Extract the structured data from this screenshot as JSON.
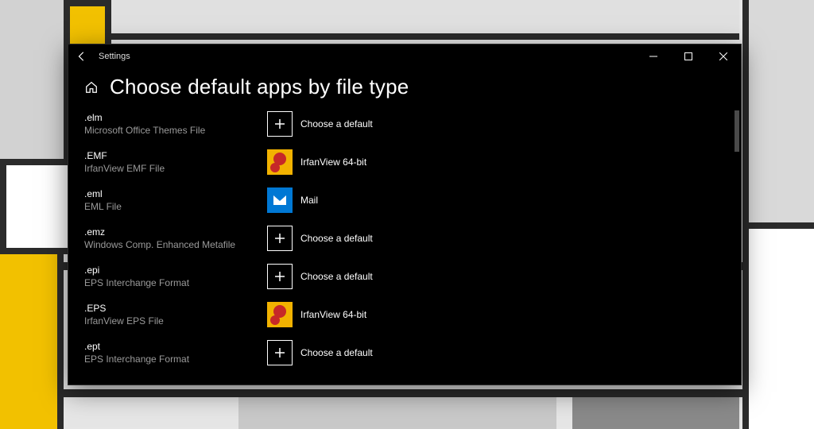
{
  "window": {
    "app_name": "Settings",
    "page_title": "Choose default apps by file type"
  },
  "apps": {
    "choose": "Choose a default",
    "irfan": "IrfanView 64-bit",
    "mail": "Mail"
  },
  "rows": [
    {
      "ext": ".elm",
      "desc": "Microsoft Office Themes File",
      "app": "choose"
    },
    {
      "ext": ".EMF",
      "desc": "IrfanView EMF File",
      "app": "irfan"
    },
    {
      "ext": ".eml",
      "desc": "EML File",
      "app": "mail"
    },
    {
      "ext": ".emz",
      "desc": "Windows Comp. Enhanced Metafile",
      "app": "choose"
    },
    {
      "ext": ".epi",
      "desc": "EPS Interchange Format",
      "app": "choose"
    },
    {
      "ext": ".EPS",
      "desc": "IrfanView EPS File",
      "app": "irfan"
    },
    {
      "ext": ".ept",
      "desc": "EPS Interchange Format",
      "app": "choose"
    }
  ]
}
